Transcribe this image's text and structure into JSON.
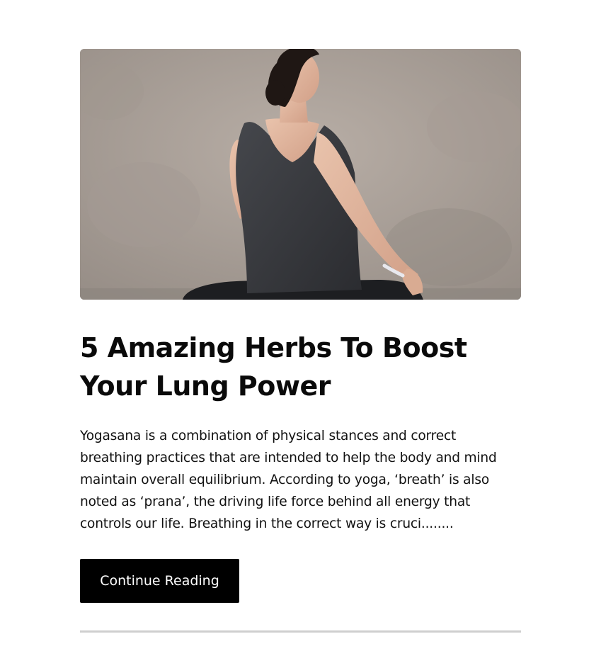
{
  "post": {
    "image_alt": "Woman in a dark tank top doing a seated twisting yoga pose against a grey concrete wall",
    "title": "5 Amazing Herbs To Boost Your Lung Power",
    "excerpt": "Yogasana is a combination of physical stances and correct breathing practices that are intended to help the body and mind maintain overall equilibrium. According to yoga, ‘breath’ is also noted as ‘prana’, the driving life force behind all energy that controls our life. Breathing in the correct way is cruci........",
    "button_label": "Continue Reading"
  },
  "colors": {
    "button_bg": "#000000",
    "button_text": "#ffffff",
    "divider": "#cfcfcf",
    "title": "#0a0a0a"
  }
}
